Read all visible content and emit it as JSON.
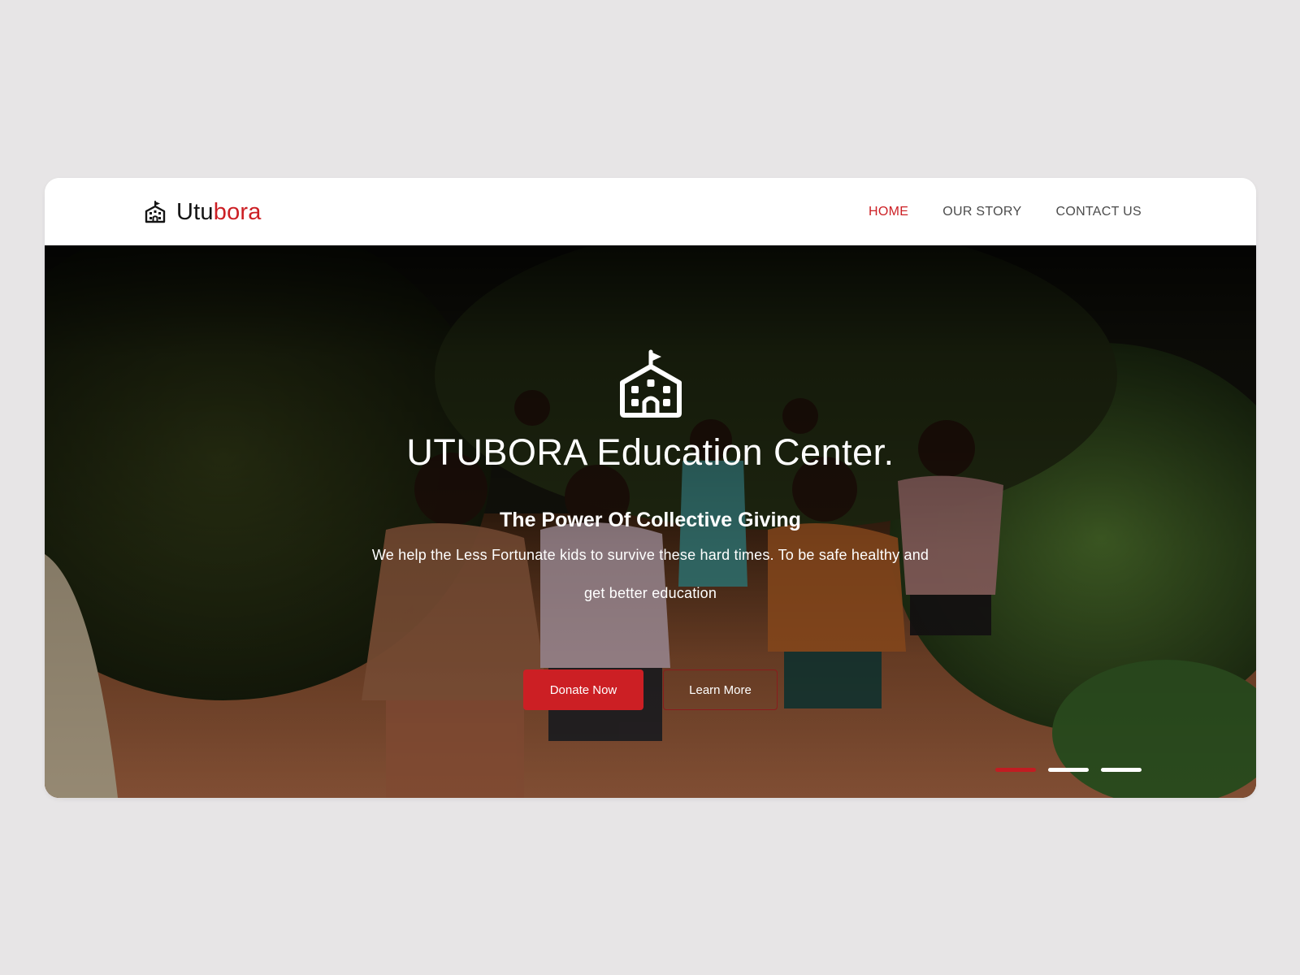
{
  "brand": {
    "name_prefix": "Utu",
    "name_accent": "bora",
    "icon": "school-icon"
  },
  "nav": {
    "items": [
      {
        "label": "HOME",
        "active": true
      },
      {
        "label": "OUR STORY",
        "active": false
      },
      {
        "label": "CONTACT US",
        "active": false
      }
    ]
  },
  "hero": {
    "icon": "school-icon",
    "title": "UTUBORA Education Center.",
    "subtitle": "The Power Of Collective Giving",
    "description": "We help the Less Fortunate kids to survive these hard times. To be safe healthy and get better education",
    "primary_button": "Donate Now",
    "secondary_button": "Learn More",
    "slides": {
      "count": 3,
      "active_index": 0
    }
  },
  "colors": {
    "accent": "#cc1f24",
    "page_background": "#e7e5e6",
    "nav_text": "#4b4b4b",
    "hero_text": "#ffffff"
  }
}
